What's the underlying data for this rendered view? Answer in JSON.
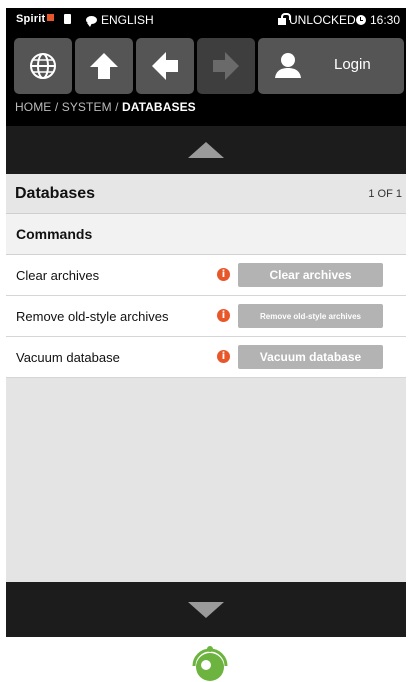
{
  "status_bar": {
    "brand": "Spirit",
    "language": "ENGLISH",
    "lock_state": "UNLOCKED",
    "time": "16:30",
    "brand_color": "#e8572a"
  },
  "nav": {
    "buttons": [
      {
        "icon": "globe-icon"
      },
      {
        "icon": "arrow-up-icon"
      },
      {
        "icon": "arrow-left-icon"
      },
      {
        "icon": "arrow-right-icon",
        "disabled": true
      },
      {
        "icon": "user-icon"
      }
    ],
    "login_label": "Login"
  },
  "breadcrumb": {
    "home": "HOME",
    "separator1": " / ",
    "system": "SYSTEM",
    "separator2": " / ",
    "current": "DATABASES"
  },
  "page": {
    "title": "Databases",
    "count": "1 OF 1"
  },
  "section": {
    "title": "Commands"
  },
  "commands": [
    {
      "label": "Clear archives",
      "button": "Clear archives"
    },
    {
      "label": "Remove old-style archives",
      "button": "Remove old-style archives"
    },
    {
      "label": "Vacuum database",
      "button": "Vacuum database"
    }
  ],
  "colors": {
    "accent": "#e8572a",
    "logo": "#6cb33f",
    "button": "#b3b3b3"
  }
}
